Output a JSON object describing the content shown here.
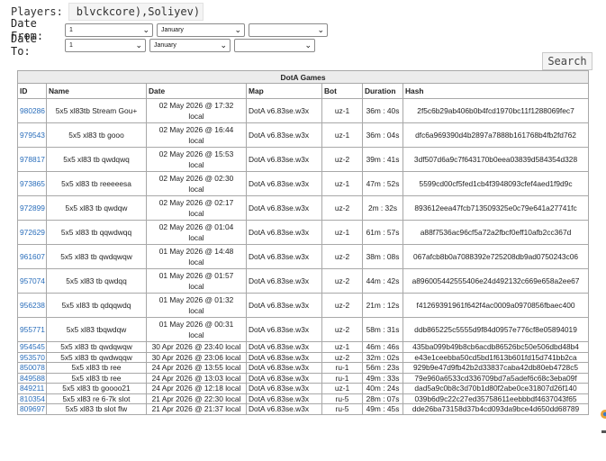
{
  "filters": {
    "players_label": "Players:",
    "players_value": "blvckcore),Soliyev)",
    "date_from_label": "Date From:",
    "date_to_label": "Date To:",
    "date_from": {
      "day": "1",
      "month": "January",
      "year": ""
    },
    "date_to": {
      "day": "1",
      "month": "January",
      "year": ""
    }
  },
  "search_label": "Search",
  "table": {
    "caption": "DotA Games",
    "headers": [
      "ID",
      "Name",
      "Date",
      "Map",
      "Bot",
      "Duration",
      "Hash"
    ],
    "rows": [
      {
        "id": "980286",
        "name": "5x5 xl83tb Stream Gou+",
        "date": "02 May 2026 @ 17:32",
        "date2": "local",
        "map": "DotA v6.83se.w3x",
        "bot": "uz-1",
        "duration": "36m : 40s",
        "hash": "2f5c6b29ab406b0b4fcd1970bc11f1288069fec7"
      },
      {
        "id": "979543",
        "name": "5x5 xl83 tb gooo",
        "date": "02 May 2026 @ 16:44",
        "date2": "local",
        "map": "DotA v6.83se.w3x",
        "bot": "uz-1",
        "duration": "36m : 04s",
        "hash": "dfc6a969390d4b2897a7888b161768b4fb2fd762"
      },
      {
        "id": "978817",
        "name": "5x5 xl83 tb qwdqwq",
        "date": "02 May 2026 @ 15:53",
        "date2": "local",
        "map": "DotA v6.83se.w3x",
        "bot": "uz-2",
        "duration": "39m : 41s",
        "hash": "3df507d6a9c7f643170b0eea03839d584354d328"
      },
      {
        "id": "973865",
        "name": "5x5 xl83 tb reeeeesa",
        "date": "02 May 2026 @ 02:30",
        "date2": "local",
        "map": "DotA v6.83se.w3x",
        "bot": "uz-1",
        "duration": "47m : 52s",
        "hash": "5599cd00cf5fed1cb4f3948093cfef4aed1f9d9c"
      },
      {
        "id": "972899",
        "name": "5x5 xl83 tb qwdqw",
        "date": "02 May 2026 @ 02:17",
        "date2": "local",
        "map": "DotA v6.83se.w3x",
        "bot": "uz-2",
        "duration": "2m : 32s",
        "hash": "893612eea47fcb713509325e0c79e641a27741fc"
      },
      {
        "id": "972629",
        "name": "5x5 xl83 tb qqwdwqq",
        "date": "02 May 2026 @ 01:04",
        "date2": "local",
        "map": "DotA v6.83se.w3x",
        "bot": "uz-1",
        "duration": "61m : 57s",
        "hash": "a88f7536ac96cf5a72a2fbcf0eff10afb2cc367d"
      },
      {
        "id": "961607",
        "name": "5x5 xl83 tb qwdqwqw",
        "date": "01 May 2026 @ 14:48",
        "date2": "local",
        "map": "DotA v6.83se.w3x",
        "bot": "uz-2",
        "duration": "38m : 08s",
        "hash": "067afcb8b0a7088392e725208db9ad0750243c06"
      },
      {
        "id": "957074",
        "name": "5x5 xl83 tb qwdqq",
        "date": "01 May 2026 @ 01:57",
        "date2": "local",
        "map": "DotA v6.83se.w3x",
        "bot": "uz-2",
        "duration": "44m : 42s",
        "hash": "a896005442555406e24d492132c669e658a2ee67"
      },
      {
        "id": "956238",
        "name": "5x5 xl83 tb qdqqwdq",
        "date": "01 May 2026 @ 01:32",
        "date2": "local",
        "map": "DotA v6.83se.w3x",
        "bot": "uz-2",
        "duration": "21m : 12s",
        "hash": "f41269391961f642f4ac0009a0970856fbaec400"
      },
      {
        "id": "955771",
        "name": "5x5 xl83 tbqwdqw",
        "date": "01 May 2026 @ 00:31",
        "date2": "local",
        "map": "DotA v6.83se.w3x",
        "bot": "uz-2",
        "duration": "58m : 31s",
        "hash": "ddb865225c5555d9f84d0957e776cf8e05894019"
      },
      {
        "id": "954545",
        "name": "5x5 xl83 tb qwdqwqw",
        "date": "30 Apr 2026 @ 23:40 local",
        "date2": "",
        "map": "DotA v6.83se.w3x",
        "bot": "uz-1",
        "duration": "46m : 46s",
        "hash": "435ba099b49b8cb6acdb86526bc50e506dbd48b4"
      },
      {
        "id": "953570",
        "name": "5x5 xl83 tb qwdwqqw",
        "date": "30 Apr 2026 @ 23:06 local",
        "date2": "",
        "map": "DotA v6.83se.w3x",
        "bot": "uz-2",
        "duration": "32m : 02s",
        "hash": "e43e1ceebba50cd5bd1f613b601fd15d741bb2ca"
      },
      {
        "id": "850078",
        "name": "5x5 xl83 tb ree",
        "date": "24 Apr 2026 @ 13:55 local",
        "date2": "",
        "map": "DotA v6.83se.w3x",
        "bot": "ru-1",
        "duration": "56m : 23s",
        "hash": "929b9e47d9fb42b2d33837caba42db80eb4728c5"
      },
      {
        "id": "849588",
        "name": "5x5 xl83 tb ree",
        "date": "24 Apr 2026 @ 13:03 local",
        "date2": "",
        "map": "DotA v6.83se.w3x",
        "bot": "ru-1",
        "duration": "49m : 33s",
        "hash": "79e960a6533cd336709bd7a5adef6c68c3eba09f"
      },
      {
        "id": "849211",
        "name": "5x5 xl83 tb goooo21",
        "date": "24 Apr 2026 @ 12:18 local",
        "date2": "",
        "map": "DotA v6.83se.w3x",
        "bot": "uz-1",
        "duration": "40m : 24s",
        "hash": "dad5a9c0b8c3d70b1d80f2abe0ce31807d26f140"
      },
      {
        "id": "810354",
        "name": "5x5 xl83 re 6-7k slot",
        "date": "21 Apr 2026 @ 22:30 local",
        "date2": "",
        "map": "DotA v6.83se.w3x",
        "bot": "ru-5",
        "duration": "28m : 07s",
        "hash": "039b6d9c22c27ed35758611eebbbdf4637043f65"
      },
      {
        "id": "809697",
        "name": "5x5 xl83 tb slot flw",
        "date": "21 Apr 2026 @ 21:37 local",
        "date2": "",
        "map": "DotA v6.83se.w3x",
        "bot": "ru-5",
        "duration": "49m : 45s",
        "hash": "dde26ba73158d37b4cd093da9bce4d650dd68789"
      }
    ]
  }
}
